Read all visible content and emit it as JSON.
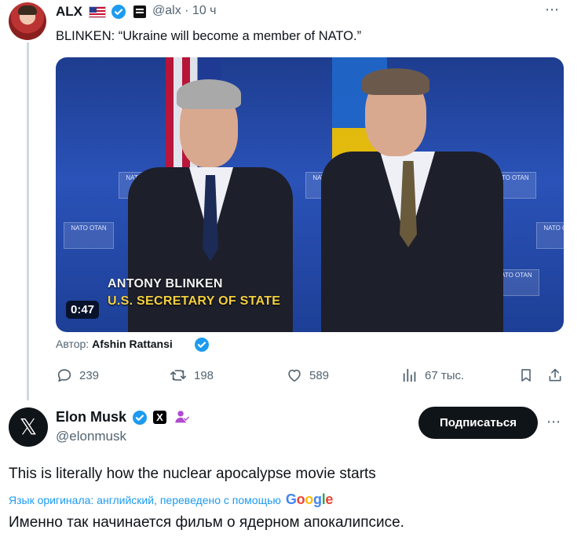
{
  "tweet1": {
    "display_name": "ALX",
    "handle": "@alx",
    "time": "· 10 ч",
    "text": "BLINKEN: “Ukraine will become a member of NATO.”",
    "video": {
      "caption_name": "ANTONY BLINKEN",
      "caption_title": "U.S. SECRETARY OF STATE",
      "duration": "0:47",
      "nato_tag_text": "NATO OTAN"
    },
    "author_label": "Автор:",
    "author_name": "Afshin Rattansi",
    "actions": {
      "replies": "239",
      "retweets": "198",
      "likes": "589",
      "views": "67 тыс."
    },
    "more_icon": "⋯"
  },
  "tweet2": {
    "avatar_glyph": "𝕏",
    "display_name": "Elon Musk",
    "handle": "@elonmusk",
    "x_badge": "X",
    "subscribe_label": "Подписаться",
    "more_icon": "⋯",
    "text": "This is literally how the nuclear apocalypse movie starts",
    "translation_note": "Язык оригинала: английский, переведено с помощью",
    "translator_letters": [
      "G",
      "o",
      "o",
      "g",
      "l",
      "e"
    ],
    "translated_text": "Именно так начинается фильм о ядерном апокалипсисе."
  },
  "colors": {
    "accent": "#1d9bf0",
    "text": "#0f1419",
    "secondary": "#536471",
    "verified": "#1d9bf0"
  },
  "icons": [
    "verified-badge-icon",
    "flag-us-icon",
    "news-badge-icon",
    "reply-icon",
    "retweet-icon",
    "like-icon",
    "views-icon",
    "bookmark-icon",
    "share-icon",
    "x-badge-icon",
    "person-badge-icon",
    "more-icon"
  ]
}
